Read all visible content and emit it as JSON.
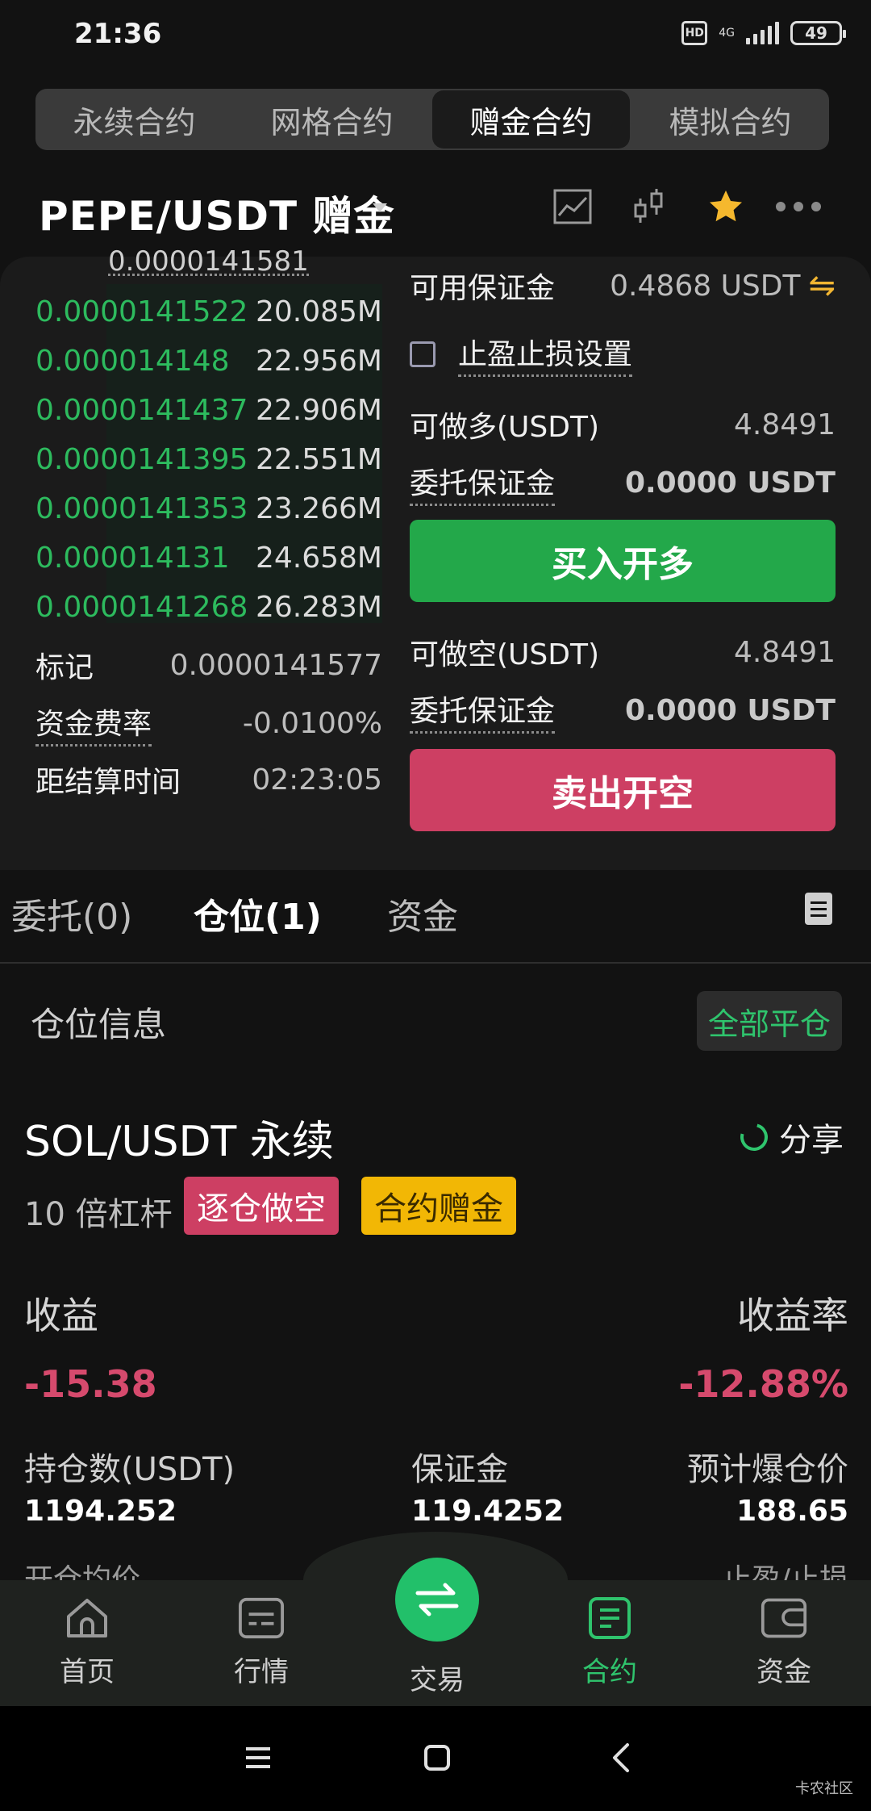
{
  "status_bar": {
    "time": "21:36",
    "hd": "HD",
    "network": "4G",
    "battery": "49"
  },
  "contract_tabs": [
    {
      "label": "永续合约",
      "active": false
    },
    {
      "label": "网格合约",
      "active": false
    },
    {
      "label": "赠金合约",
      "active": true
    },
    {
      "label": "模拟合约",
      "active": false
    }
  ],
  "pair": {
    "title": "PEPE/USDT 赠金"
  },
  "order_book": {
    "top_price": "0.0000141581",
    "rows": [
      {
        "price": "0.0000141522",
        "qty": "20.085M"
      },
      {
        "price": "0.000014148",
        "qty": "22.956M"
      },
      {
        "price": "0.0000141437",
        "qty": "22.906M"
      },
      {
        "price": "0.0000141395",
        "qty": "22.551M"
      },
      {
        "price": "0.0000141353",
        "qty": "23.266M"
      },
      {
        "price": "0.000014131",
        "qty": "24.658M"
      },
      {
        "price": "0.0000141268",
        "qty": "26.283M"
      }
    ],
    "mark_label": "标记",
    "mark_value": "0.0000141577",
    "funding_label": "资金费率",
    "funding_value": "-0.0100%",
    "settle_label": "距结算时间",
    "settle_value": "02:23:05"
  },
  "order_form": {
    "available_label": "可用保证金",
    "available_value": "0.4868 USDT",
    "tpsl_label": "止盈止损设置",
    "long_max_label": "可做多(USDT)",
    "long_max_value": "4.8491",
    "long_margin_label": "委托保证金",
    "long_margin_value": "0.0000 USDT",
    "buy_button": "买入开多",
    "short_max_label": "可做空(USDT)",
    "short_max_value": "4.8491",
    "short_margin_label": "委托保证金",
    "short_margin_value": "0.0000 USDT",
    "sell_button": "卖出开空"
  },
  "position_tabs": [
    {
      "label": "委托(0)",
      "active": false
    },
    {
      "label": "仓位(1)",
      "active": true
    },
    {
      "label": "资金",
      "active": false
    }
  ],
  "position": {
    "section_label": "仓位信息",
    "close_all": "全部平仓",
    "symbol": "SOL/USDT 永续",
    "share": "分享",
    "leverage": "10 倍杠杆",
    "badge_mode": "逐仓做空",
    "badge_bonus": "合约赠金",
    "pnl_label": "收益",
    "pnl_value": "-15.38",
    "roi_label": "收益率",
    "roi_value": "-12.88%",
    "size_label": "持仓数(USDT)",
    "size_value": "1194.252",
    "margin_label": "保证金",
    "margin_value": "119.4252",
    "liq_label": "预计爆仓价",
    "liq_value": "188.65",
    "entry_label": "开仓均价",
    "tpsl_label": "止盈/止损"
  },
  "bottom_nav": [
    {
      "label": "首页",
      "icon": "home-icon",
      "active": false
    },
    {
      "label": "行情",
      "icon": "market-icon",
      "active": false
    },
    {
      "label": "交易",
      "icon": "trade-swap-icon",
      "active": false
    },
    {
      "label": "合约",
      "icon": "contract-icon",
      "active": true
    },
    {
      "label": "资金",
      "icon": "wallet-icon",
      "active": false
    }
  ],
  "watermark": "卡农社区",
  "colors": {
    "green": "#23a84a",
    "red": "#cd3f63",
    "yellow": "#f2b705",
    "accent_green": "#2fc46d"
  }
}
